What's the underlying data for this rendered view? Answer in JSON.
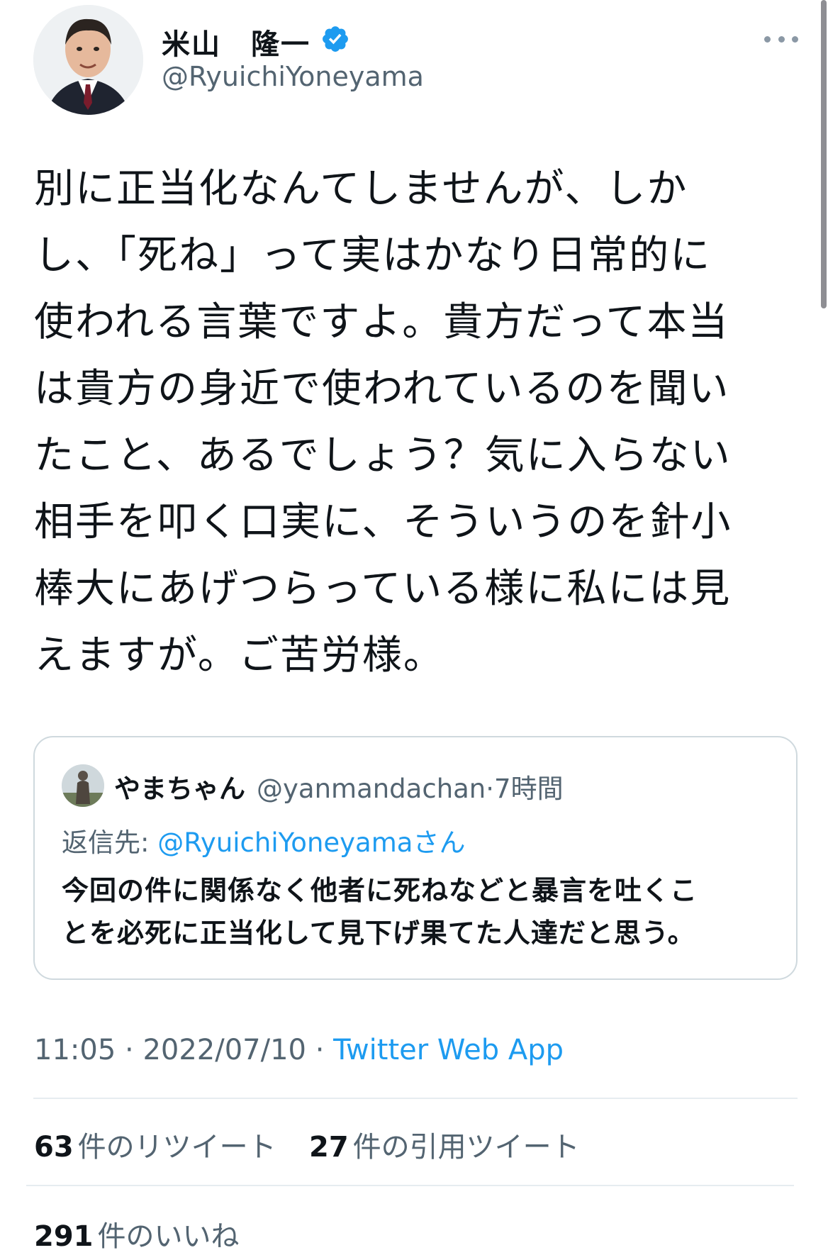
{
  "author": {
    "display_name": "米山　隆一",
    "handle": "@RyuichiYoneyama",
    "avatar_icon": "user-photo",
    "verified_icon": "verified-badge-icon"
  },
  "tweet": {
    "body_lines": [
      "別に正当化なんてしませんが、しか",
      "し、「死ね」って実はかなり日常的に",
      "使われる言葉ですよ。貴方だって本当",
      "は貴方の身近で使われているのを聞い",
      "たこと、あるでしょう？気に入らない",
      "相手を叩く口実に、そういうのを針小",
      "棒大にあげつらっている様に私には見",
      "えますが。ご苦労様。"
    ]
  },
  "quote": {
    "name": "やまちゃん",
    "handle": "@yanmandachan",
    "separator": "·",
    "time": "7時間",
    "reply_label": "返信先:",
    "reply_mention": "@RyuichiYoneyamaさん",
    "text_lines": [
      "今回の件に関係なく他者に死ねなどと暴言を吐くこ",
      "とを必死に正当化して見下げ果てた人達だと思う。"
    ]
  },
  "meta": {
    "time": "11:05",
    "sep1": " · ",
    "date": "2022/07/10",
    "sep2": " · ",
    "source": "Twitter Web App"
  },
  "stats": {
    "retweets_count": "63",
    "retweets_label": "件のリツイート",
    "quotes_count": "27",
    "quotes_label": "件の引用ツイート",
    "likes_count": "291",
    "likes_label": "件のいいね"
  },
  "colors": {
    "accent": "#1d9bf0",
    "secondary_text": "#536471",
    "primary_text": "#0f1419",
    "border": "#cfd9de"
  }
}
